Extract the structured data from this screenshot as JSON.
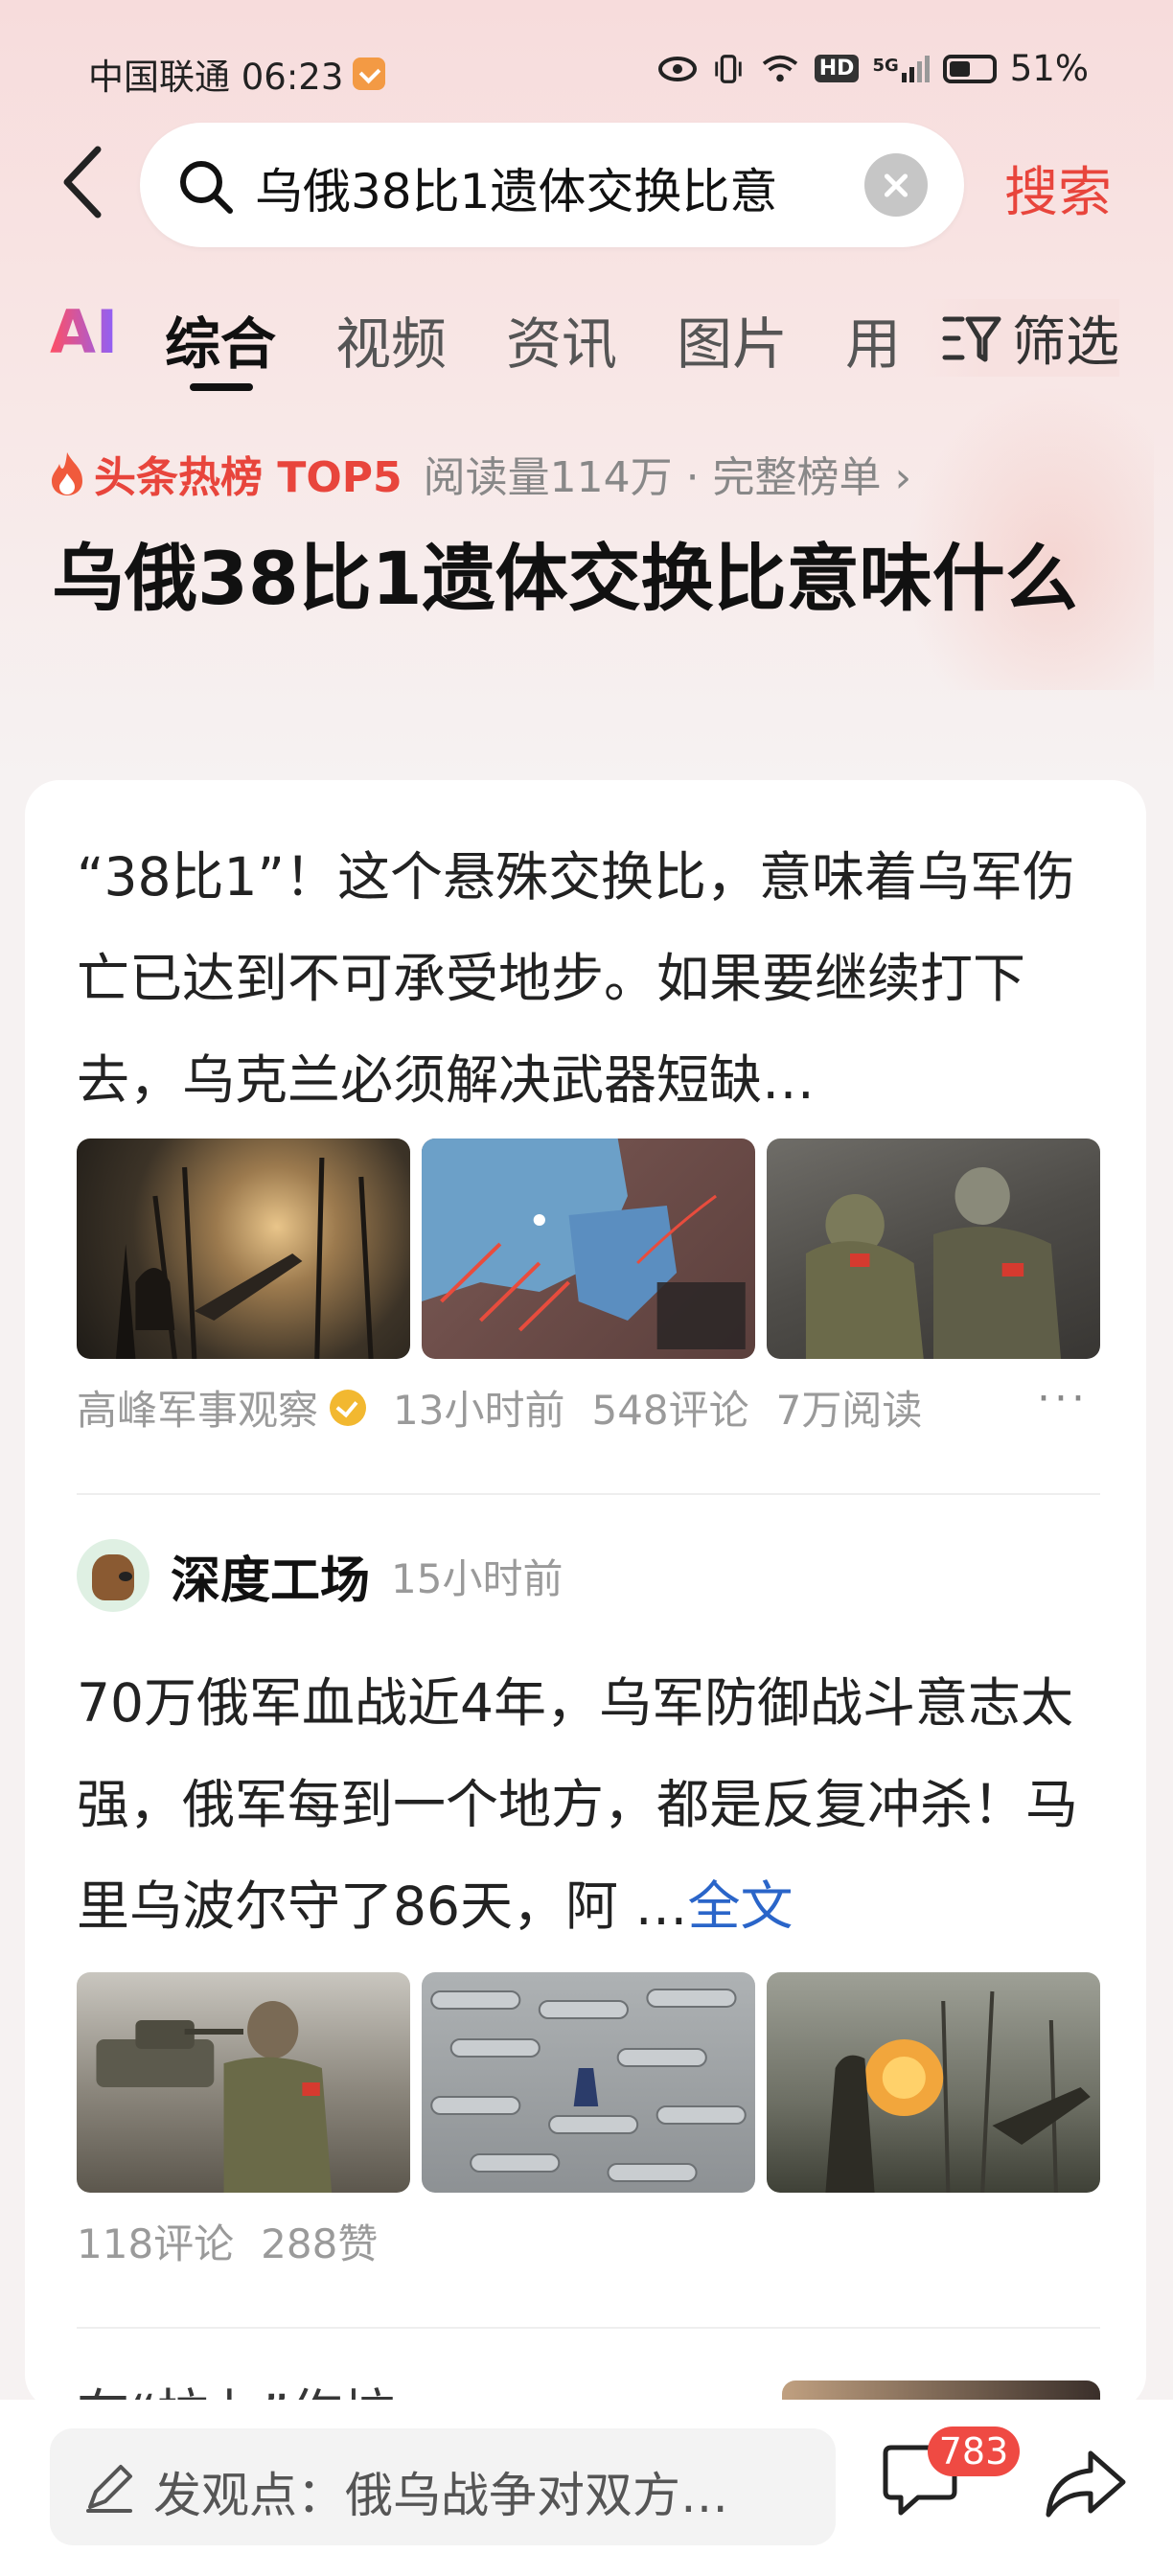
{
  "status_bar": {
    "carrier_time": "中国联通 06:23",
    "network_label": "HD",
    "signal_label": "5G",
    "battery_text": "51%",
    "battery_level": 0.51
  },
  "search": {
    "query": "乌俄38比1遗体交换比意",
    "button_label": "搜索"
  },
  "tabs": {
    "ai_label": "AI",
    "items": [
      "综合",
      "视频",
      "资讯",
      "图片",
      "用"
    ],
    "active": "综合",
    "filter_label": "筛选"
  },
  "hot_list": {
    "rank_label": "头条热榜 TOP5",
    "reads_label": "阅读量114万 · 完整榜单 ›"
  },
  "headline": "乌俄38比1遗体交换比意味什么",
  "articles": [
    {
      "text": "“38比1”！这个悬殊交换比，意味着乌军伤亡已达到不可承受地步。如果要继续打下去，乌克兰必须解决武器短缺…",
      "source": "高峰军事观察",
      "time": "13小时前",
      "comments": "548评论",
      "reads": "7万阅读",
      "more": "···"
    },
    {
      "author": "深度工场",
      "time": "15小时前",
      "text": "70万俄军血战近4年，乌军防御战斗意志太强，俄军每到一个地方，都是反复冲杀！马里乌波尔守了86天，阿 …",
      "full_text_link": "全文",
      "comments": "118评论",
      "likes": "288赞"
    }
  ],
  "next_article_partial": "在“拉七”作坊……",
  "bottom_bar": {
    "comment_placeholder": "发观点：俄乌战争对双方…",
    "comment_count": "783"
  },
  "colors": {
    "accent_red": "#e8453c",
    "link_blue": "#2a65c9",
    "verified_gold": "#f2b830"
  }
}
